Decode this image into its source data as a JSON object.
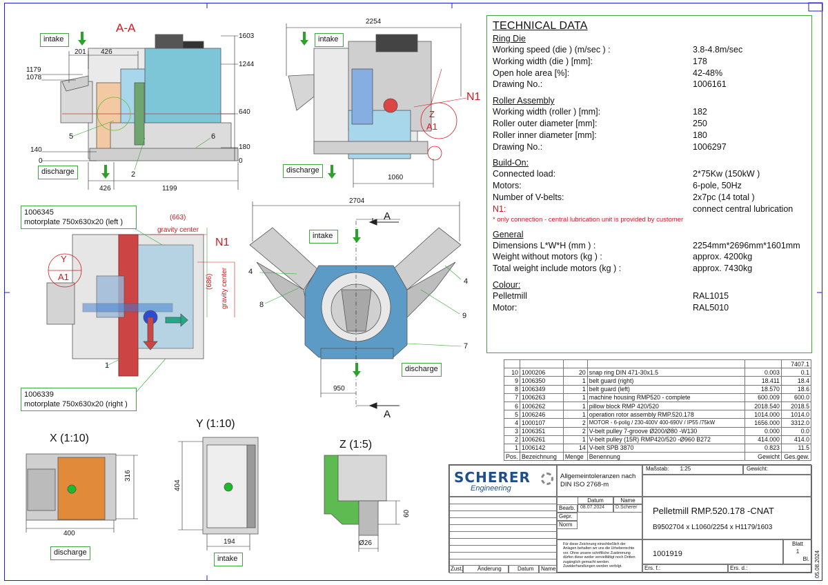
{
  "views": {
    "aa_title": "A-A",
    "x_title": "X (1:10)",
    "y_title": "Y (1:10)",
    "z_title": "Z (1:5)",
    "n1": "N1",
    "a_mark": "A",
    "y_mark": "Y",
    "a1_mark": "A1",
    "z_mark": "Z"
  },
  "labels": {
    "intake": "intake",
    "discharge": "discharge",
    "motorplate_left_no": "1006345",
    "motorplate_left": "motorplate 750x630x20   (left )",
    "motorplate_right_no": "1006339",
    "motorplate_right": "motorplate 750x630x20   (right )",
    "gravity_center": "gravity center",
    "gc_val_663": "(663)",
    "gc_val_686": "(686)"
  },
  "dims": {
    "d201": "201",
    "d426a": "426",
    "d1179": "1179",
    "d1078": "1078",
    "d140": "140",
    "d0a": "0",
    "d426b": "426",
    "d1199": "1199",
    "d1603": "1603",
    "d1244": "1244",
    "d640": "640",
    "d180": "180",
    "d0b": "0",
    "d2254": "2254",
    "d1060": "1060",
    "d2704": "2704",
    "d950": "950",
    "d316": "316",
    "d400": "400",
    "d404": "404",
    "d194": "194",
    "d60": "60",
    "d26": "Ø26"
  },
  "callouts": {
    "c5": "5",
    "c2": "2",
    "c6": "6",
    "c1": "1",
    "c4a": "4",
    "c4b": "4",
    "c8": "8",
    "c9": "9",
    "c7": "7"
  },
  "technical": {
    "title": "TECHNICAL DATA",
    "ring_die": {
      "heading": "Ring Die",
      "rows": [
        {
          "k": "Working speed    (die )       (m/sec ) :",
          "v": "3.8-4.8m/sec"
        },
        {
          "k": "Working width    (die )   [mm]:",
          "v": "178"
        },
        {
          "k": "Open hole area [%]:",
          "v": "42-48%"
        },
        {
          "k": "Drawing No.:",
          "v": "1006161"
        }
      ]
    },
    "roller": {
      "heading": "Roller Assembly",
      "rows": [
        {
          "k": "Working width    (roller )  [mm]:",
          "v": "182"
        },
        {
          "k": "Roller outer diameter [mm]:",
          "v": "250"
        },
        {
          "k": "Roller inner diameter [mm]:",
          "v": "180"
        },
        {
          "k": "Drawing No.:",
          "v": "1006297"
        }
      ]
    },
    "buildon": {
      "heading": "Build-On:",
      "rows": [
        {
          "k": "Connected load:",
          "v": "2*75Kw    (150kW )"
        },
        {
          "k": "Motors:",
          "v": "6-pole, 50Hz"
        },
        {
          "k": "Number of V-belts:",
          "v": "2x7pc    (14 total )"
        }
      ],
      "n1_key": "N1:",
      "n1_val": "connect central lubrication",
      "note": "* only connection - central lubrication unit is provided by customer"
    },
    "general": {
      "heading": "General",
      "rows": [
        {
          "k": "Dimensions L*W*H     (mm ) :",
          "v": "2254mm*2696mm*1601mm"
        },
        {
          "k": "Weight without motors     (kg ) :",
          "v": "approx. 4200kg"
        },
        {
          "k": "Total weight include motors      (kg ) :",
          "v": "approx. 7430kg"
        }
      ]
    },
    "colour": {
      "heading": "Colour:",
      "rows": [
        {
          "k": "Pelletmill",
          "v": "RAL1015"
        },
        {
          "k": "Motor:",
          "v": "RAL5010"
        }
      ]
    }
  },
  "parts": {
    "total": "7407.1",
    "rows": [
      {
        "pos": "10",
        "no": "1000206",
        "qty": "20",
        "name": "snap ring DIN 471-30x1.5",
        "w": "0.003",
        "tw": "0.1"
      },
      {
        "pos": "9",
        "no": "1006350",
        "qty": "1",
        "name": "belt guard (right)",
        "w": "18.411",
        "tw": "18.4"
      },
      {
        "pos": "8",
        "no": "1006349",
        "qty": "1",
        "name": "belt guard (left)",
        "w": "18.570",
        "tw": "18.6"
      },
      {
        "pos": "7",
        "no": "1006263",
        "qty": "1",
        "name": "machine housing RMP520 - complete",
        "w": "600.009",
        "tw": "600.0"
      },
      {
        "pos": "6",
        "no": "1006262",
        "qty": "1",
        "name": "pillow block RMP 420/520",
        "w": "2018.540",
        "tw": "2018.5"
      },
      {
        "pos": "5",
        "no": "1006246",
        "qty": "1",
        "name": "operation rotor assembly RMP.520.178",
        "w": "1014.000",
        "tw": "1014.0"
      },
      {
        "pos": "4",
        "no": "1000107",
        "qty": "2",
        "name": "MOTOR - 6-polig / 230-400V 400-690V / IP55 /75kW",
        "w": "1656.000",
        "tw": "3312.0"
      },
      {
        "pos": "3",
        "no": "1006351",
        "qty": "2",
        "name": "V-belt pulley 7-groove Ø200/Ø80 -W130",
        "w": "0.000",
        "tw": "0.0"
      },
      {
        "pos": "2",
        "no": "1006261",
        "qty": "1",
        "name": "V-belt pulley (15R) RMP420/520 -Ø960 B272",
        "w": "414.000",
        "tw": "414.0"
      },
      {
        "pos": "1",
        "no": "1006142",
        "qty": "14",
        "name": "V-belt SPB 3870",
        "w": "0.823",
        "tw": "11.5"
      }
    ],
    "header": {
      "pos": "Pos.",
      "no": "Bezeichnung",
      "qty": "Menge",
      "name": "Benennung",
      "w": "Gewicht",
      "tw": "Ges.gew."
    }
  },
  "titleblock": {
    "logo_main": "SCHERER",
    "logo_sub": "Engineering",
    "tolerance": "Allgemeintoleranzen nach DIN ISO 2768-m",
    "scale_label": "Maßstab:",
    "scale": "1:25",
    "weight_label": "Gewicht:",
    "datum": "Datum",
    "name": "Name",
    "bearb": "Bearb.",
    "bearb_date": "08.07.2024",
    "bearb_name": "D.Scherer",
    "gepr": "Gepr.",
    "norm": "Norm",
    "title": "Pelletmill RMP.520.178 -CNAT",
    "subtitle": "B9502704 x L1060/2254 x H1179/1603",
    "drawing_no": "1001919",
    "blatt": "Blatt",
    "blatt_no": "1",
    "bl": "Bl.",
    "legal": "Für diese Zeichnung einschließlich der Anlagen behalten wir uns die Urheberrechte vor. Ohne unsere schriftliche Zustimmung dürfen diese weder vervielfältigt noch Dritten zugänglich gemacht werden. Zuwiderhandlungen werden verfolgt.",
    "zust": "Zust.",
    "aenderung": "Änderung",
    "datum2": "Datum",
    "name2": "Name",
    "ers_f": "Ers. f.:",
    "ers_d": "Ers. d.:",
    "date_vertical": "05.08.2024"
  }
}
